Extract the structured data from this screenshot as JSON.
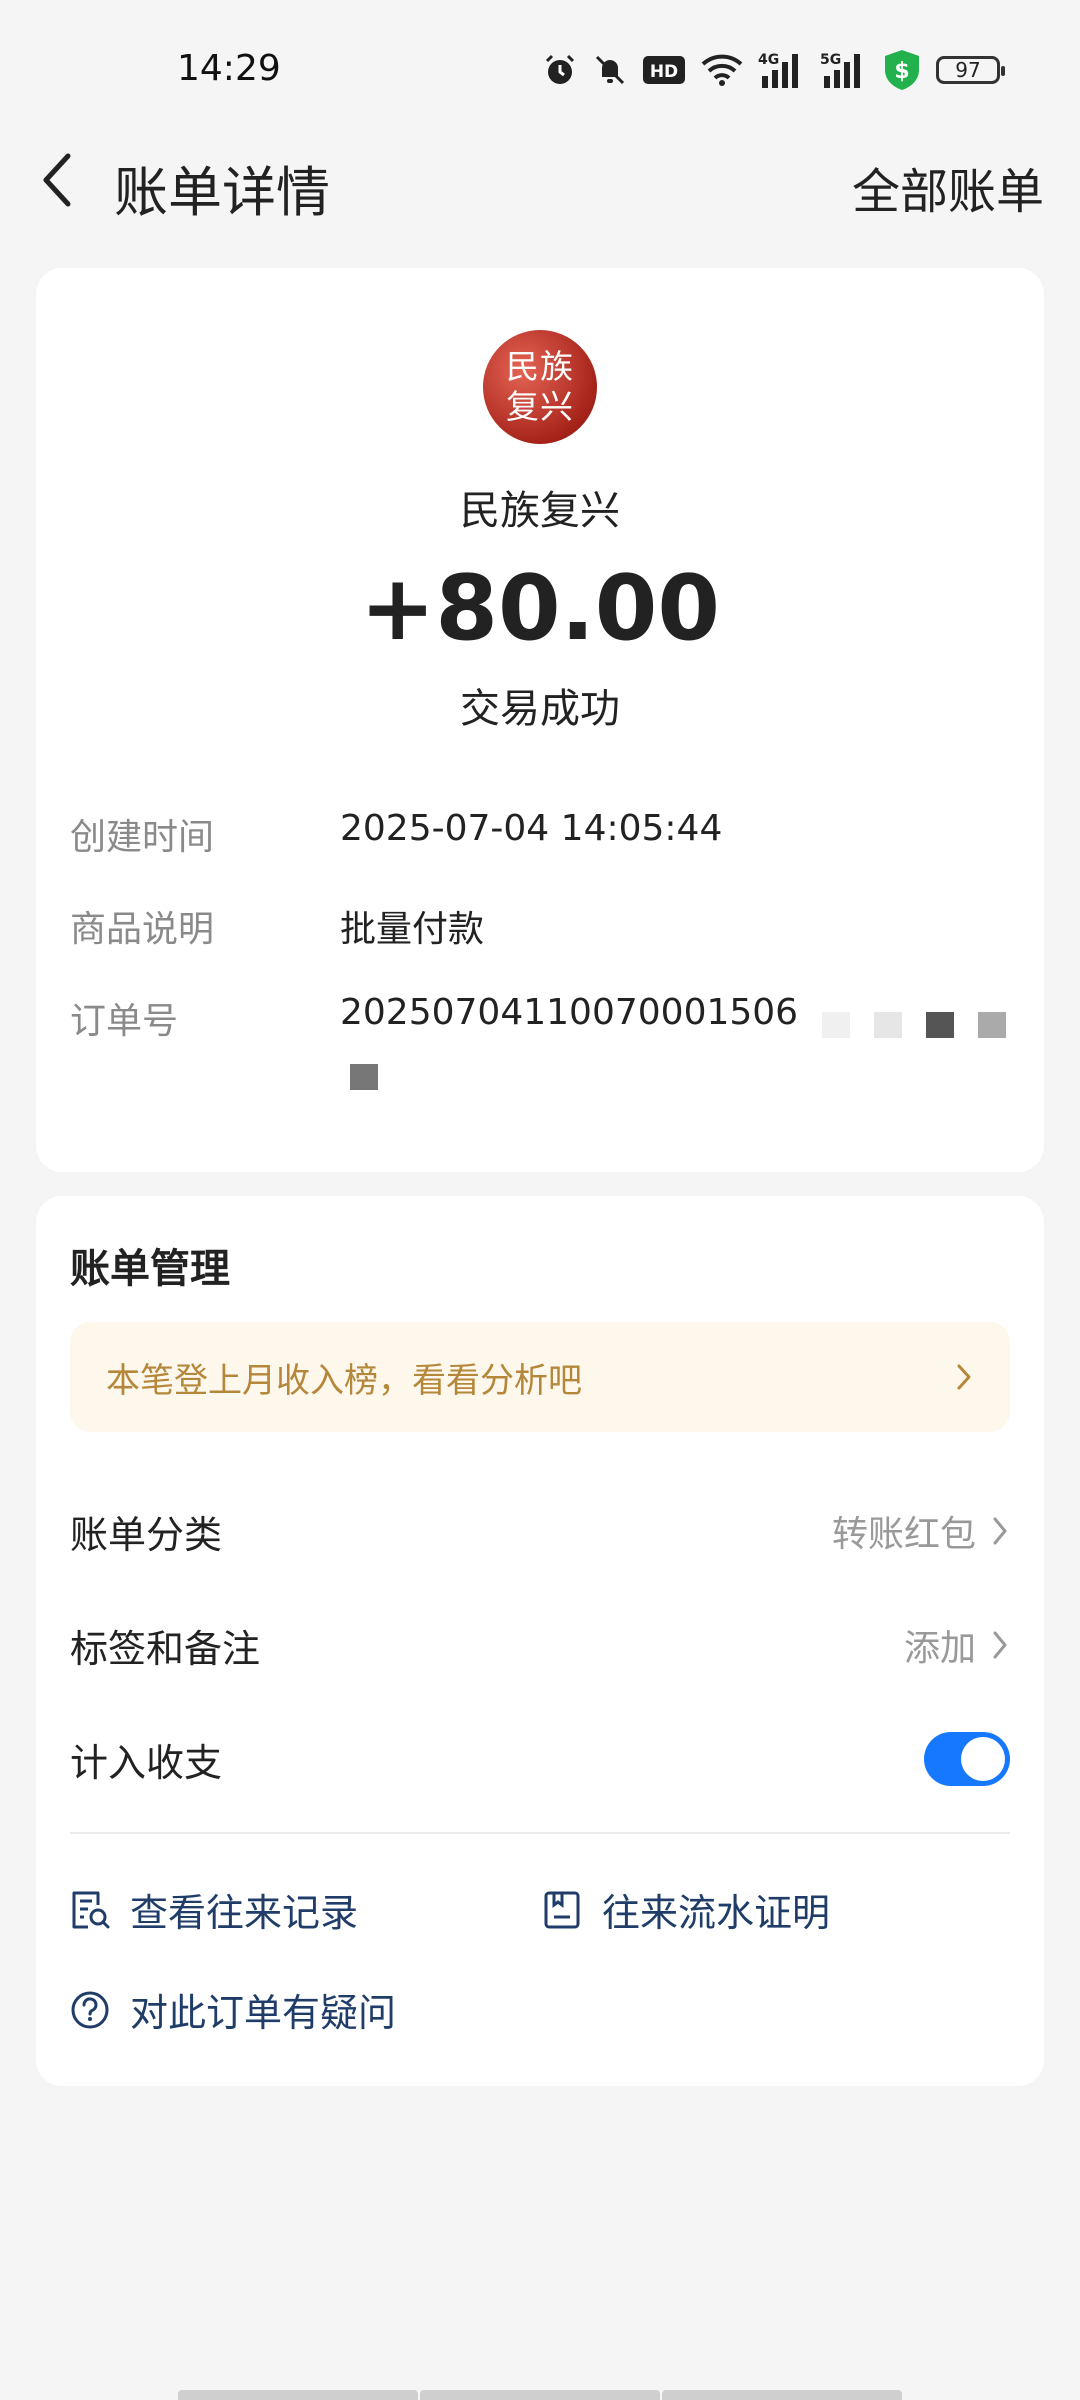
{
  "status_bar": {
    "time": "14:29",
    "battery": "97",
    "network_4g": "4G",
    "network_5g": "5G",
    "hd_label": "HD"
  },
  "header": {
    "title": "账单详情",
    "right_link": "全部账单"
  },
  "transaction": {
    "avatar_text": "民族复兴",
    "payer": "民族复兴",
    "amount": "+80.00",
    "status": "交易成功",
    "details": [
      {
        "label": "创建时间",
        "value": "2025-07-04 14:05:44"
      },
      {
        "label": "商品说明",
        "value": "批量付款"
      },
      {
        "label": "订单号",
        "value": "20250704110070001506"
      }
    ]
  },
  "management": {
    "title": "账单管理",
    "promo_text": "本笔登上月收入榜，看看分析吧",
    "rows": [
      {
        "label": "账单分类",
        "value": "转账红包"
      },
      {
        "label": "标签和备注",
        "value": "添加"
      },
      {
        "label": "计入收支",
        "toggle_on": true
      }
    ],
    "links": [
      {
        "label": "查看往来记录",
        "icon": "record-search-icon"
      },
      {
        "label": "往来流水证明",
        "icon": "statement-icon"
      },
      {
        "label": "对此订单有疑问",
        "icon": "question-circle-icon"
      }
    ]
  },
  "colors": {
    "accent": "#1677ff",
    "link": "#1f3d68",
    "promo_text": "#b5873a",
    "promo_bg": "#fdf7ec",
    "security_green": "#22b14c"
  }
}
